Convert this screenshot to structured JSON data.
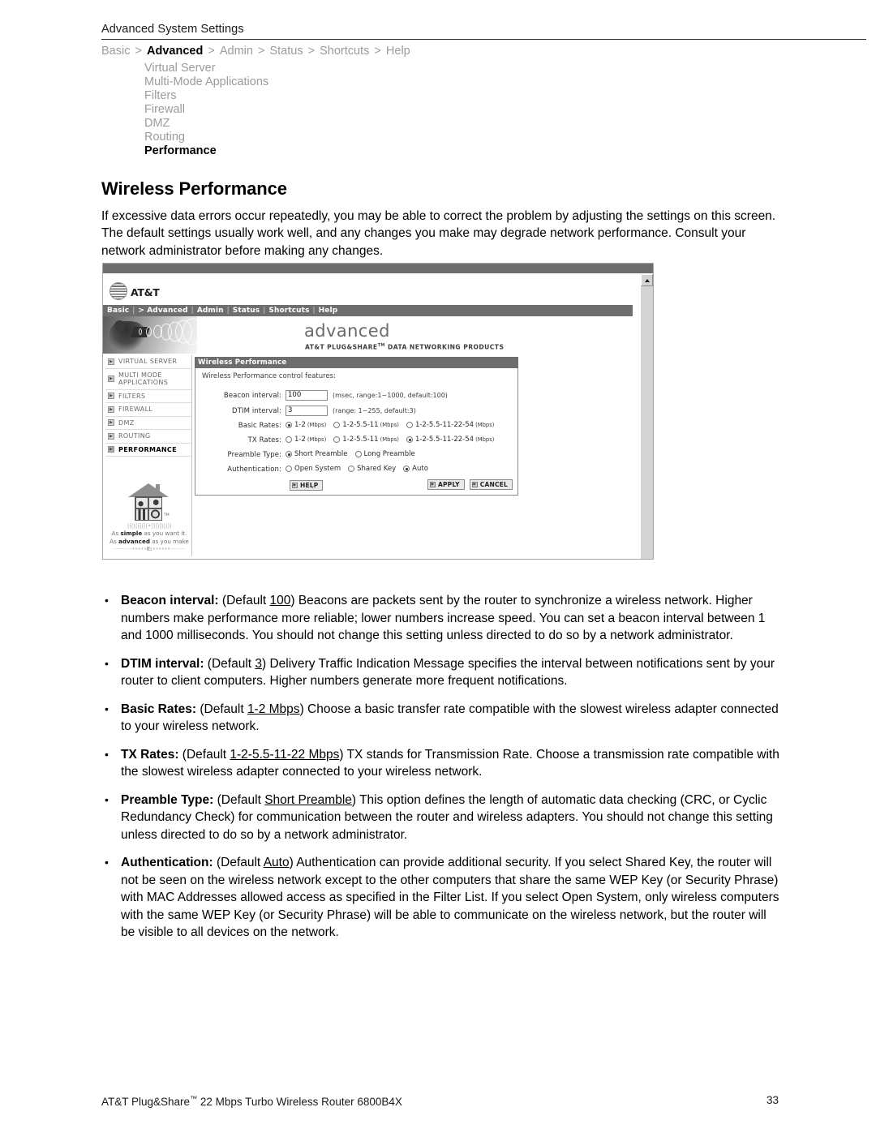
{
  "runhead": {
    "title": "Advanced System Settings"
  },
  "breadcrumb": {
    "items": [
      "Basic",
      "Advanced",
      "Admin",
      "Status",
      "Shortcuts",
      "Help"
    ],
    "current": "Advanced",
    "separator": ">"
  },
  "subnav": {
    "items": [
      "Virtual Server",
      "Multi-Mode Applications",
      "Filters",
      "Firewall",
      "DMZ",
      "Routing",
      "Performance"
    ],
    "active": "Performance"
  },
  "heading": "Wireless Performance",
  "intro": "If excessive data errors occur repeatedly, you may be able to correct the problem by adjusting the settings on this screen. The default settings usually work well, and any changes you make may degrade network performance. Consult your network administrator before making any changes.",
  "screenshot": {
    "brand": "AT&T",
    "nav": {
      "items": [
        "Basic",
        "> Advanced",
        "Admin",
        "Status",
        "Shortcuts",
        "Help"
      ],
      "separator": "|"
    },
    "banner": {
      "title": "advanced",
      "subtitle": "AT&T PLUG&SHARE",
      "subtitle_tm": "TM",
      "subtitle_rest": " DATA NETWORKING PRODUCTS"
    },
    "menu": {
      "items": [
        {
          "label": "VIRTUAL SERVER",
          "selected": false
        },
        {
          "label": "MULTI MODE APPLICATIONS",
          "selected": false
        },
        {
          "label": "FILTERS",
          "selected": false
        },
        {
          "label": "FIREWALL",
          "selected": false
        },
        {
          "label": "DMZ",
          "selected": false
        },
        {
          "label": "ROUTING",
          "selected": false
        },
        {
          "label": "PERFORMANCE",
          "selected": true
        }
      ]
    },
    "promo": {
      "waves": "((((((((((•))))))))))",
      "line1_pre": "As ",
      "line1_bold": "simple",
      "line1_post": " as you want it.",
      "line2_pre": "As ",
      "line2_bold": "advanced",
      "line2_post": " as you make it.",
      "tm": "TM",
      "dots": "·············•••••••••••••··············"
    },
    "panel": {
      "title": "Wireless Performance",
      "lead": "Wireless Performance control features:",
      "beacon": {
        "label": "Beacon interval:",
        "value": "100",
        "hint": "(msec, range:1~1000, default:100)"
      },
      "dtim": {
        "label": "DTIM interval:",
        "value": "3",
        "hint": "(range: 1~255, default:3)"
      },
      "basic_rates": {
        "label": "Basic Rates:",
        "options": [
          {
            "text": "1-2",
            "unit": "(Mbps)",
            "selected": true
          },
          {
            "text": "1-2-5.5-11",
            "unit": "(Mbps)",
            "selected": false
          },
          {
            "text": "1-2-5.5-11-22-54",
            "unit": "(Mbps)",
            "selected": false
          }
        ]
      },
      "tx_rates": {
        "label": "TX Rates:",
        "options": [
          {
            "text": "1-2",
            "unit": "(Mbps)",
            "selected": false
          },
          {
            "text": "1-2-5.5-11",
            "unit": "(Mbps)",
            "selected": false
          },
          {
            "text": "1-2-5.5-11-22-54",
            "unit": "(Mbps)",
            "selected": true
          }
        ]
      },
      "preamble": {
        "label": "Preamble Type:",
        "options": [
          {
            "text": "Short Preamble",
            "unit": "",
            "selected": true
          },
          {
            "text": "Long Preamble",
            "unit": "",
            "selected": false
          }
        ]
      },
      "authentication": {
        "label": "Authentication:",
        "options": [
          {
            "text": "Open System",
            "unit": "",
            "selected": false
          },
          {
            "text": "Shared Key",
            "unit": "",
            "selected": false
          },
          {
            "text": "Auto",
            "unit": "",
            "selected": true
          }
        ]
      },
      "apply_label": "APPLY",
      "cancel_label": "CANCEL",
      "help_label": "HELP"
    }
  },
  "bullets": [
    {
      "term": "Beacon interval:",
      "default_pre": " (Default ",
      "default_value": "100",
      "default_post": ") ",
      "body": "Beacons are packets sent by the router to synchronize a wireless network. Higher numbers make performance more reliable; lower numbers increase speed. You can set a beacon interval between 1 and 1000 milliseconds. You should not change this setting unless directed to do so by a network administrator."
    },
    {
      "term": "DTIM interval:",
      "default_pre": " (Default ",
      "default_value": "3",
      "default_post": ") ",
      "body": "Delivery Traffic Indication Message specifies the interval between notifications sent by your router to client computers. Higher numbers generate more frequent notifications."
    },
    {
      "term": "Basic Rates:",
      "default_pre": " (Default ",
      "default_value": "1-2 Mbps",
      "default_post": ") ",
      "body": "Choose a basic transfer rate compatible with the slowest wireless adapter connected to your wireless network."
    },
    {
      "term": "TX Rates:",
      "default_pre": " (Default ",
      "default_value": "1-2-5.5-11-22 Mbps",
      "default_post": ") ",
      "body": "TX stands for Transmission Rate. Choose a transmission rate compatible with the slowest wireless adapter connected to your wireless network."
    },
    {
      "term": "Preamble Type:",
      "default_pre": " (Default ",
      "default_value": "Short Preamble",
      "default_post": ") ",
      "body": "This option defines the length of automatic data checking (CRC, or Cyclic Redundancy Check) for communication between the router and wireless adapters. You should not change this setting unless directed to do so by a network administrator."
    },
    {
      "term": "Authentication:",
      "default_pre": " (Default ",
      "default_value": "Auto",
      "default_post": ") ",
      "body": "Authentication can provide additional security. If you select Shared Key, the router will not be seen on the wireless network except to the other computers that share the same WEP Key (or Security Phrase) with MAC Addresses allowed access as specified in the Filter List. If you select Open System, only wireless computers with the same WEP Key (or Security Phrase) will be able to communicate on the wireless network, but the router will be visible to all devices on the network."
    }
  ],
  "footer": {
    "text_pre": "AT&T Plug&Share",
    "tm": "™",
    "text_post": " 22 Mbps Turbo Wireless Router 6800B4X",
    "page": "33"
  }
}
